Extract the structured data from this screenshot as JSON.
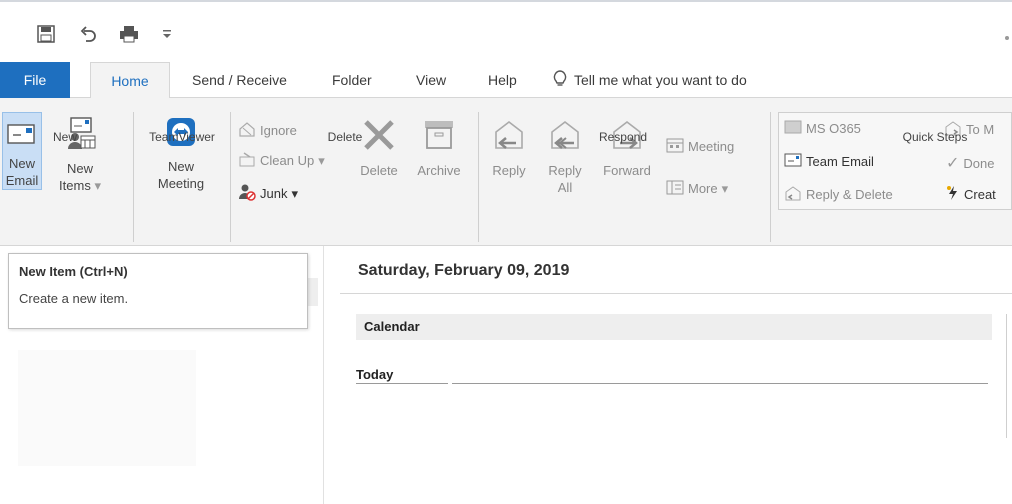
{
  "tabs": {
    "file": "File",
    "home": "Home",
    "send_receive": "Send / Receive",
    "folder": "Folder",
    "view": "View",
    "help": "Help",
    "tell_me": "Tell me what you want to do"
  },
  "ribbon": {
    "new_group": {
      "label": "New",
      "new_email": [
        "New",
        "Email"
      ],
      "new_items": [
        "New",
        "Items"
      ]
    },
    "teamviewer_group": {
      "label": "TeamViewer",
      "new_meeting": [
        "New",
        "Meeting"
      ]
    },
    "delete_group": {
      "label": "Delete",
      "ignore": "Ignore",
      "clean_up": "Clean Up",
      "junk": "Junk",
      "delete": "Delete",
      "archive": "Archive"
    },
    "respond_group": {
      "label": "Respond",
      "reply": "Reply",
      "reply_all": [
        "Reply",
        "All"
      ],
      "forward": "Forward",
      "meeting": "Meeting",
      "more": "More"
    },
    "quick_steps_group": {
      "label": "Quick Steps",
      "ms_o365": "MS O365",
      "team_email": "Team Email",
      "reply_delete": "Reply & Delete",
      "to_manager": "To M",
      "done": "Done",
      "create_new": "Creat"
    }
  },
  "tooltip": {
    "title": "New Item (Ctrl+N)",
    "description": "Create a new item."
  },
  "calendar": {
    "date_heading": "Saturday, February 09, 2019",
    "section": "Calendar",
    "today": "Today"
  },
  "colors": {
    "accent": "#1e6fbf",
    "ribbon_bg": "#f3f3f3",
    "pressed": "#c9def5"
  },
  "icons": [
    "save-icon",
    "undo-icon",
    "print-icon",
    "customize-qat-icon",
    "new-email-icon",
    "new-items-icon",
    "teamviewer-icon",
    "ignore-icon",
    "clean-up-icon",
    "junk-icon",
    "delete-icon",
    "archive-icon",
    "reply-icon",
    "reply-all-icon",
    "forward-icon",
    "meeting-icon",
    "more-icon",
    "lightbulb-icon"
  ]
}
